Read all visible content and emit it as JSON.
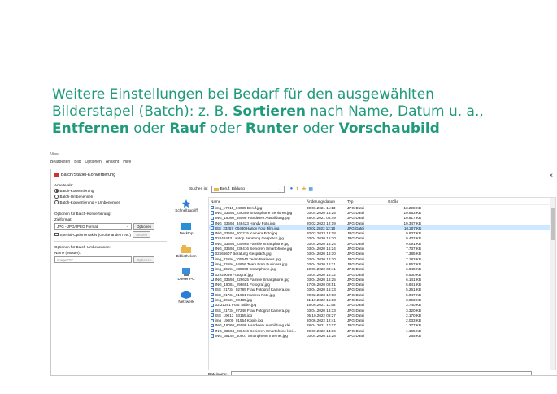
{
  "caption": {
    "line1": "Weitere Einstellungen bei Bedarf für den ausgewählten",
    "line2_pre": "Bilderstapel (Batch): z. B. ",
    "sortieren": "Sortieren",
    "line2_post": " nach Name, Datum u. a.,",
    "entfernen": "Entfernen",
    "oder1": " oder ",
    "rauf": "Rauf",
    "oder2": " oder ",
    "runter": "Runter",
    "oder3": " oder ",
    "vorschau": "Vorschaubild"
  },
  "background": {
    "view": "View",
    "menu": [
      "Bearbeiten",
      "Bild",
      "Optionen",
      "Ansicht",
      "Hilfe"
    ]
  },
  "dialog": {
    "title": "Batch/Stapel-Konvertierung",
    "close": "×",
    "arbeite_als": "Arbeite als:",
    "mode_options": [
      "Batch-Konvertierung",
      "Batch-Umbenennen",
      "Batch-Konvertierung + Umbenennen"
    ],
    "optionen_konv": "Optionen für Batch-Konvertierung:",
    "zielformat_label": "Zielformat:",
    "zielformat_value": "JPG - JPG/JPEG Format",
    "optionen_btn": "Optionen",
    "spezial": "Spezial-Optionen aktiv (Größe ändern etc.)",
    "setzen_btn": "Setzen",
    "optionen_umb": "Optionen für Batch-Umbenennen:",
    "name_muster_label": "Name (Muster):",
    "name_muster_value": "image###",
    "optionen_btn2": "Optionen",
    "suchen_in_label": "Suchen in:",
    "suchen_in_value": "Beruf. Bildung",
    "sidebar": [
      "Schnellzugriff",
      "Desktop",
      "Bibliotheken",
      "Dieser PC",
      "Netzwerk"
    ],
    "columns": [
      "Name",
      "Änderungsdatum",
      "Typ",
      "Größe"
    ],
    "files": [
      [
        "img_17215_04085 Beruf.jpg",
        "30.06.2021 11:13",
        "JPG-Datei",
        "13.298 KB"
      ],
      [
        "ING_33594_236389 Smartphone Senioren.jpg",
        "03.04.2020 16:25",
        "JPG-Datei",
        "10.953 KB"
      ],
      [
        "ING_19060_85098 Handwerk Ausbildung.jpg",
        "28.04.2021 08:49",
        "JPG-Datei",
        "10.817 KB"
      ],
      [
        "ING_33594_346423 Handy Foto.jpg",
        "20.02.2023 12:19",
        "JPG-Datei",
        "10.347 KB"
      ],
      [
        "ISS_23257_00480 Handy Foto Film.jpg",
        "20.02.2023 12:18",
        "JPG-Datei",
        "10.207 KB"
      ],
      [
        "ING_33594_207215 Kamera Foto.jpg",
        "20.02.2023 12:18",
        "JPG-Datei",
        "9.937 KB"
      ],
      [
        "02648433 Laptop Beratung Gespräch.jpg",
        "03.04.2020 16:30",
        "JPG-Datei",
        "9.432 KB"
      ],
      [
        "ING_33594_230965 Familie Smartphone.jpg",
        "03.04.2020 16:24",
        "JPG-Datei",
        "9.091 KB"
      ],
      [
        "ING_33594_236416 Senioren Smartphone.jpg",
        "03.04.2020 16:24",
        "JPG-Datei",
        "7.737 KB"
      ],
      [
        "02b65607 Beratung Gespräch.jpg",
        "03.04.2020 16:30",
        "JPG-Datei",
        "7.385 KB"
      ],
      [
        "img_33594_105640 Team Business.jpg",
        "03.04.2020 16:30",
        "JPG-Datei",
        "7.183 KB"
      ],
      [
        "img_33594_84656 Team Büro Business.jpg",
        "03.04.2020 16:31",
        "JPG-Datei",
        "6.867 KB"
      ],
      [
        "img_33594_135868 Smartphone.jpg",
        "10.06.2020 09:41",
        "JPG-Datei",
        "6.848 KB"
      ],
      [
        "02e29039 Fotograf.jpg",
        "03.04.2020 16:32",
        "JPG-Datei",
        "6.530 KB"
      ],
      [
        "ING_33594_229625 Familie Smartphone.jpg",
        "03.04.2020 16:25",
        "JPG-Datei",
        "6.141 KB"
      ],
      [
        "ING_19061_298651 Fotograf.jpg",
        "17.06.2020 08:51",
        "JPG-Datei",
        "5.641 KB"
      ],
      [
        "ISS_21734_02789 Frau Fotograf Kamera.jpg",
        "03.04.2020 16:33",
        "JPG-Datei",
        "5.261 KB"
      ],
      [
        "ISS_21734_01661 Kamera Foto.jpg",
        "20.02.2023 12:18",
        "JPG-Datei",
        "5.047 KB"
      ],
      [
        "img_39524_00435.jpg",
        "31.10.2022 15:13",
        "JPG-Datei",
        "3.993 KB"
      ],
      [
        "02f21261 Frau Tablet.jpg",
        "15.06.2021 11:55",
        "JPG-Datei",
        "3.740 KB"
      ],
      [
        "ISS_21734_07248 Frau Fotograf Kamera.jpg",
        "03.04.2020 16:33",
        "JPG-Datei",
        "3.320 KB"
      ],
      [
        "ISS_19013_03155.jpg",
        "05.10.2022 08:27",
        "JPG-Datei",
        "2.170 KB"
      ],
      [
        "img_19000_01554 Kopie.jpg",
        "20.06.2022 12:41",
        "JPG-Datei",
        "2.033 KB"
      ],
      [
        "ING_19060_85098 Handwerk Ausbildung klei...",
        "28.04.2021 10:17",
        "JPG-Datei",
        "1.277 KB"
      ],
      [
        "ING_33594_236416 Senioren Smartphone klei...",
        "09.09.2022 14:36",
        "JPG-Datei",
        "1.195 KB"
      ],
      [
        "ING_38192_40907 Smartphone Internet.jpg",
        "03.04.2020 16:28",
        "JPG-Datei",
        "265 KB"
      ]
    ],
    "selected_index": 4,
    "dateiname_label": "Dateiname:"
  }
}
